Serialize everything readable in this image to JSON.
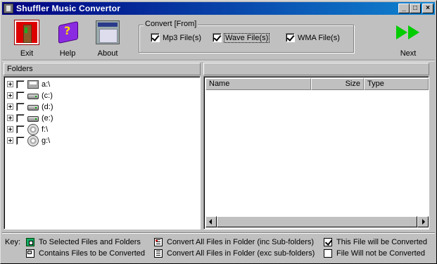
{
  "window": {
    "title": "Shuffler Music Convertor",
    "controls": {
      "minimize": "_",
      "maximize": "□",
      "close": "×"
    }
  },
  "toolbar": {
    "exit_label": "Exit",
    "help_label": "Help",
    "about_label": "About",
    "next_label": "Next",
    "exit_icon": "door-exit-icon",
    "help_icon": "help-book-icon",
    "about_icon": "about-window-icon",
    "next_icon": "double-arrow-right-icon",
    "next_color": "#00cc00"
  },
  "convert": {
    "legend": "Convert [From]",
    "options": [
      {
        "label": "Mp3 File(s)",
        "checked": true
      },
      {
        "label": "Wave File(s)",
        "checked": true
      },
      {
        "label": "WMA File(s)",
        "checked": true
      }
    ]
  },
  "folders": {
    "header": "Folders",
    "drives": [
      {
        "label": "a:\\",
        "icon": "floppy-icon"
      },
      {
        "label": "(c:)",
        "icon": "hdd-icon"
      },
      {
        "label": "(d:)",
        "icon": "hdd-icon"
      },
      {
        "label": "(e:)",
        "icon": "hdd-icon"
      },
      {
        "label": "f:\\",
        "icon": "cd-icon"
      },
      {
        "label": "g:\\",
        "icon": "cd-icon"
      }
    ]
  },
  "files": {
    "columns": {
      "name": "Name",
      "size": "Size",
      "type": "Type"
    }
  },
  "key": {
    "label": "Key:",
    "items": {
      "selected": "To Selected Files and Folders",
      "contains": "Contains Files to be Converted",
      "inc_sub": "Convert All Files in Folder (inc Sub-folders)",
      "exc_sub": "Convert All Files in Folder (exc sub-folders)",
      "will": "This File will be Converted",
      "will_not": "File Will not be Converted"
    }
  }
}
